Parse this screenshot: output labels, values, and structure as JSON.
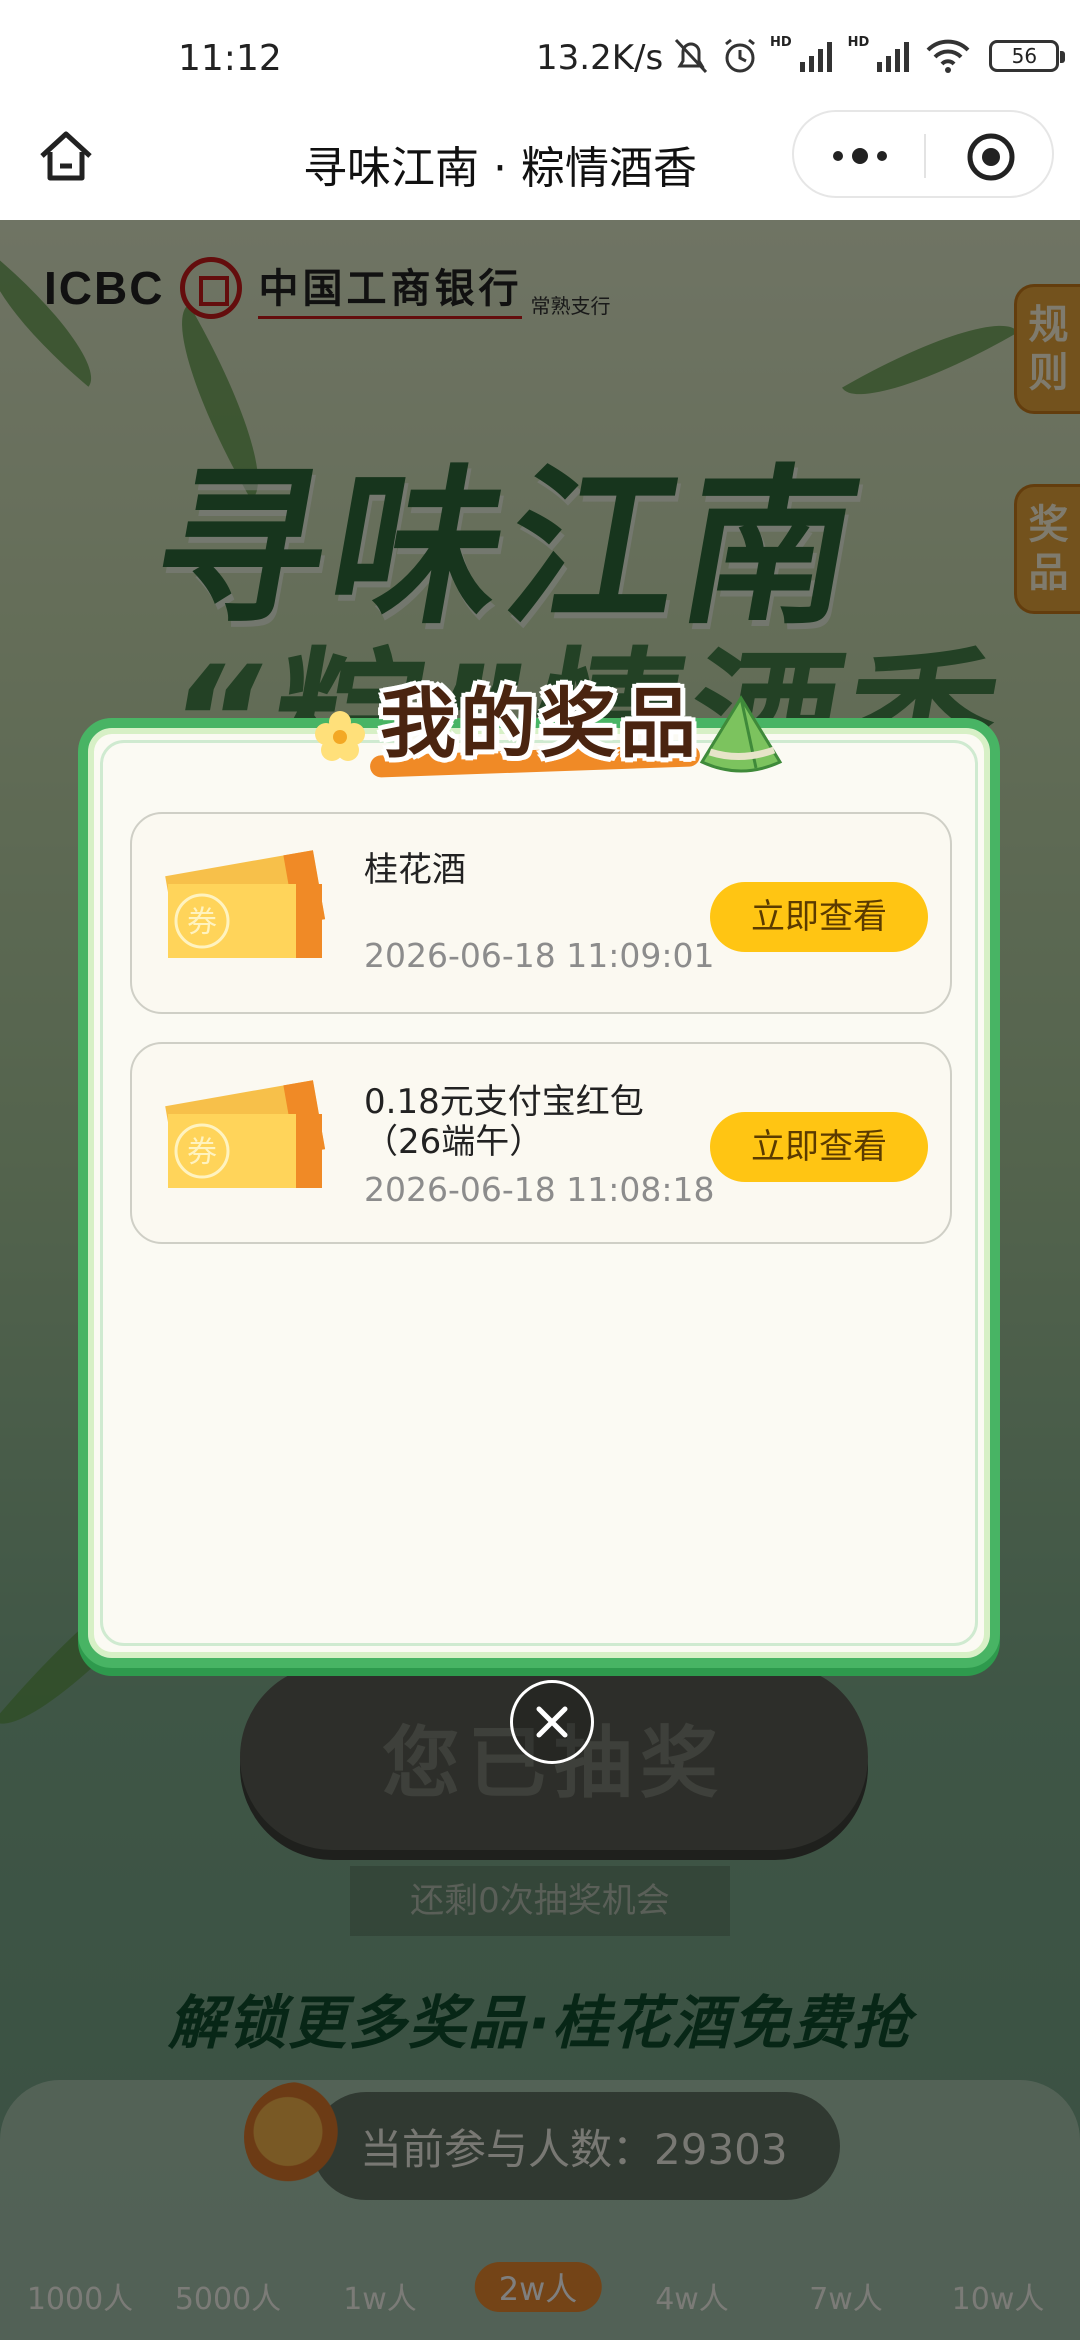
{
  "status_bar": {
    "time": "11:12",
    "net_speed": "13.2K/s",
    "battery": "56",
    "hd_label": "HD",
    "wifi_sub": "6"
  },
  "navbar": {
    "title": "寻味江南 · 粽情酒香"
  },
  "activity": {
    "bank_latin": "ICBC",
    "bank_name": "中国工商银行",
    "branch": "常熟支行",
    "headline1": "寻味江南",
    "headline2": "“粽”情酒香",
    "tab_rules": "规则",
    "tab_prizes": "奖品",
    "draw_button": "您已抽奖",
    "chances_left": "还剩0次抽奖机会",
    "unlock_text": "解锁更多奖品·桂花酒免费抢",
    "participants_label": "当前参与人数：",
    "participants_count": "29303",
    "milestones": [
      "1000人",
      "5000人",
      "1w人",
      "2w人",
      "4w人",
      "7w人",
      "10w人"
    ],
    "active_milestone": "2w人"
  },
  "modal": {
    "title": "我的奖品",
    "prizes": [
      {
        "name": "桂花酒",
        "time": "2026-06-18 11:09:01",
        "button": "立即查看"
      },
      {
        "name": "0.18元支付宝红包（26端午）",
        "name_line1": "0.18元支付宝红包",
        "name_line2": "（26端午）",
        "time": "2026-06-18 11:08:18",
        "button": "立即查看"
      }
    ],
    "coupon_char": "券",
    "coupon_side": "优惠券"
  },
  "colors": {
    "modal_border": "#48b464",
    "button_yellow": "#ffc513",
    "title_brown": "#4a2410",
    "accent_orange": "#f08a26"
  }
}
